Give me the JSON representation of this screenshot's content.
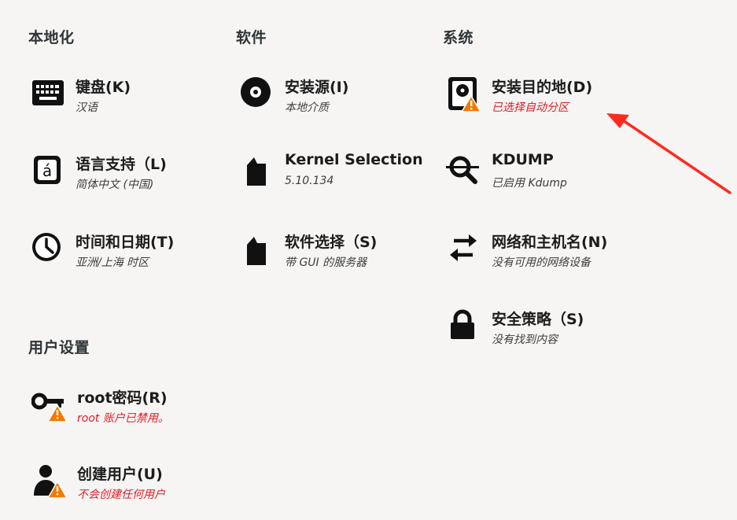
{
  "sections": {
    "localization": "本地化",
    "software": "软件",
    "system": "系统",
    "user_settings": "用户设置"
  },
  "spokes": {
    "keyboard": {
      "title": "键盘(K)",
      "status": "汉语",
      "icon": "keyboard-icon"
    },
    "language": {
      "title": "语言支持（L)",
      "status": "简体中文 (中国)",
      "icon": "language-icon"
    },
    "datetime": {
      "title": "时间和日期(T)",
      "status": "亚洲/上海 时区",
      "icon": "clock-icon"
    },
    "source": {
      "title": "安装源(I)",
      "status": "本地介质",
      "icon": "disc-icon"
    },
    "kernel": {
      "title": "Kernel Selection",
      "status": "5.10.134",
      "icon": "package-icon"
    },
    "software_selection": {
      "title": "软件选择（S)",
      "status": "带 GUI 的服务器",
      "icon": "package-icon"
    },
    "destination": {
      "title": "安装目的地(D)",
      "status": "已选择自动分区",
      "icon": "harddisk-warning-icon"
    },
    "kdump": {
      "title": "KDUMP",
      "status": "已启用 Kdump",
      "icon": "kdump-search-icon"
    },
    "network": {
      "title": "网络和主机名(N)",
      "status": "没有可用的网络设备",
      "icon": "network-arrows-icon"
    },
    "security": {
      "title": "安全策略（S)",
      "status": "没有找到内容",
      "icon": "lock-icon"
    },
    "root": {
      "title": "root密码(R)",
      "status": "root 账户已禁用。",
      "icon": "key-warning-icon"
    },
    "user": {
      "title": "创建用户(U)",
      "status": "不会创建任何用户",
      "icon": "user-warning-icon"
    }
  },
  "colors": {
    "warning_text": "#e01b24",
    "warning_badge": "#f57900",
    "annotation_arrow": "#ff2a1f"
  }
}
